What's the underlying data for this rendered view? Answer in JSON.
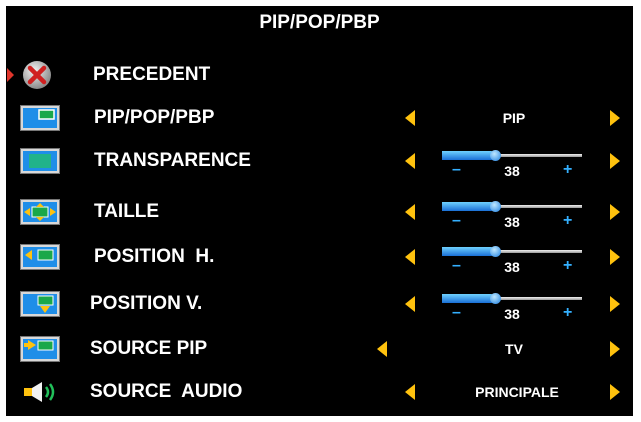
{
  "menu": {
    "title": "PIP/POP/PBP",
    "items": [
      {
        "label": "PRECEDENT",
        "icon": "back-x-icon"
      },
      {
        "label": "PIP/POP/PBP",
        "icon": "pip-screen-icon",
        "value": "PIP"
      },
      {
        "label": "TRANSPARENCE",
        "icon": "transparency-screen-icon",
        "slider_value": "38",
        "slider_fraction": 0.38
      },
      {
        "label": "TAILLE",
        "icon": "size-screen-icon",
        "slider_value": "38",
        "slider_fraction": 0.38
      },
      {
        "label": "POSITION  H.",
        "icon": "horizontal-position-icon",
        "slider_value": "38",
        "slider_fraction": 0.38
      },
      {
        "label": "POSITION V.",
        "icon": "vertical-position-icon",
        "slider_value": "38",
        "slider_fraction": 0.38
      },
      {
        "label": "SOURCE PIP",
        "icon": "source-pip-icon",
        "value": "TV"
      },
      {
        "label": "SOURCE  AUDIO",
        "icon": "speaker-icon",
        "value": "PRINCIPALE"
      }
    ],
    "slider_minus": "–",
    "slider_plus": "+"
  },
  "colors": {
    "background": "#000000",
    "arrow": "#ffc20e",
    "slider_fill": "#1e88e5",
    "slider_sign": "#34b0ff",
    "pointer": "#e0352b"
  }
}
